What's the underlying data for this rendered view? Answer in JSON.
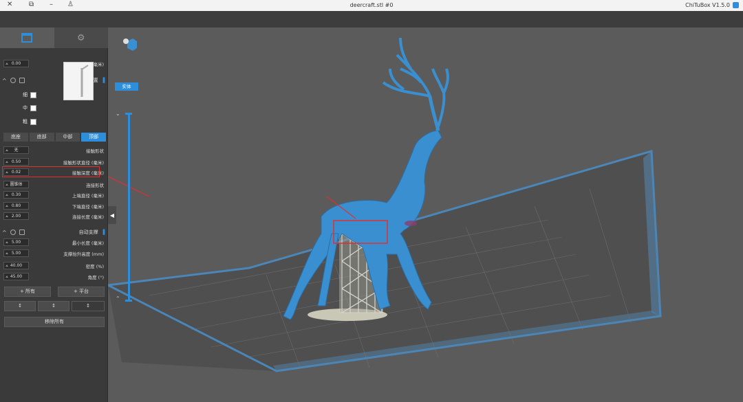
{
  "titlebar": {
    "title": "deercraft.stl #0",
    "app_name": "ChiTuBox V1.5.0"
  },
  "sidebar": {
    "lift_height": {
      "label": "Z抬升高度 (毫米)",
      "value": "0.00"
    },
    "support_settings": {
      "title": "支撑设置"
    },
    "density": {
      "high": "细",
      "medium": "中",
      "low": "粗"
    },
    "tabs": [
      "顶部",
      "中部",
      "底部",
      "底座"
    ],
    "params": [
      {
        "label": "接触形状",
        "value": "无"
      },
      {
        "label": "接触形状直径 (毫米)",
        "value": "0.50"
      },
      {
        "label": "接触深度 (毫米)",
        "value": "0.02"
      },
      {
        "label": "连接形状",
        "value": "圆锥体"
      },
      {
        "label": "上端直径 (毫米)",
        "value": "0.30"
      },
      {
        "label": "下端直径 (毫米)",
        "value": "0.80"
      },
      {
        "label": "连接长度 (毫米)",
        "value": "2.00"
      }
    ],
    "auto_support": {
      "title": "自动支撑"
    },
    "auto_params": [
      {
        "label": "最小长度 (毫米)",
        "value": "5.00"
      },
      {
        "label": "支撑抬升高度 (mm)",
        "value": "5.00"
      },
      {
        "label": "密度 (%)",
        "value": "40.00"
      },
      {
        "label": "角度 (°)",
        "value": "45.00"
      }
    ],
    "buttons": {
      "platform": "+ 平台",
      "all": "+ 所有",
      "remove_all": "移除所有"
    }
  },
  "viewport": {
    "entity_button": "实体"
  },
  "colors": {
    "accent": "#2d8fdc",
    "model": "#3a8fd0",
    "highlight": "#e03030"
  }
}
